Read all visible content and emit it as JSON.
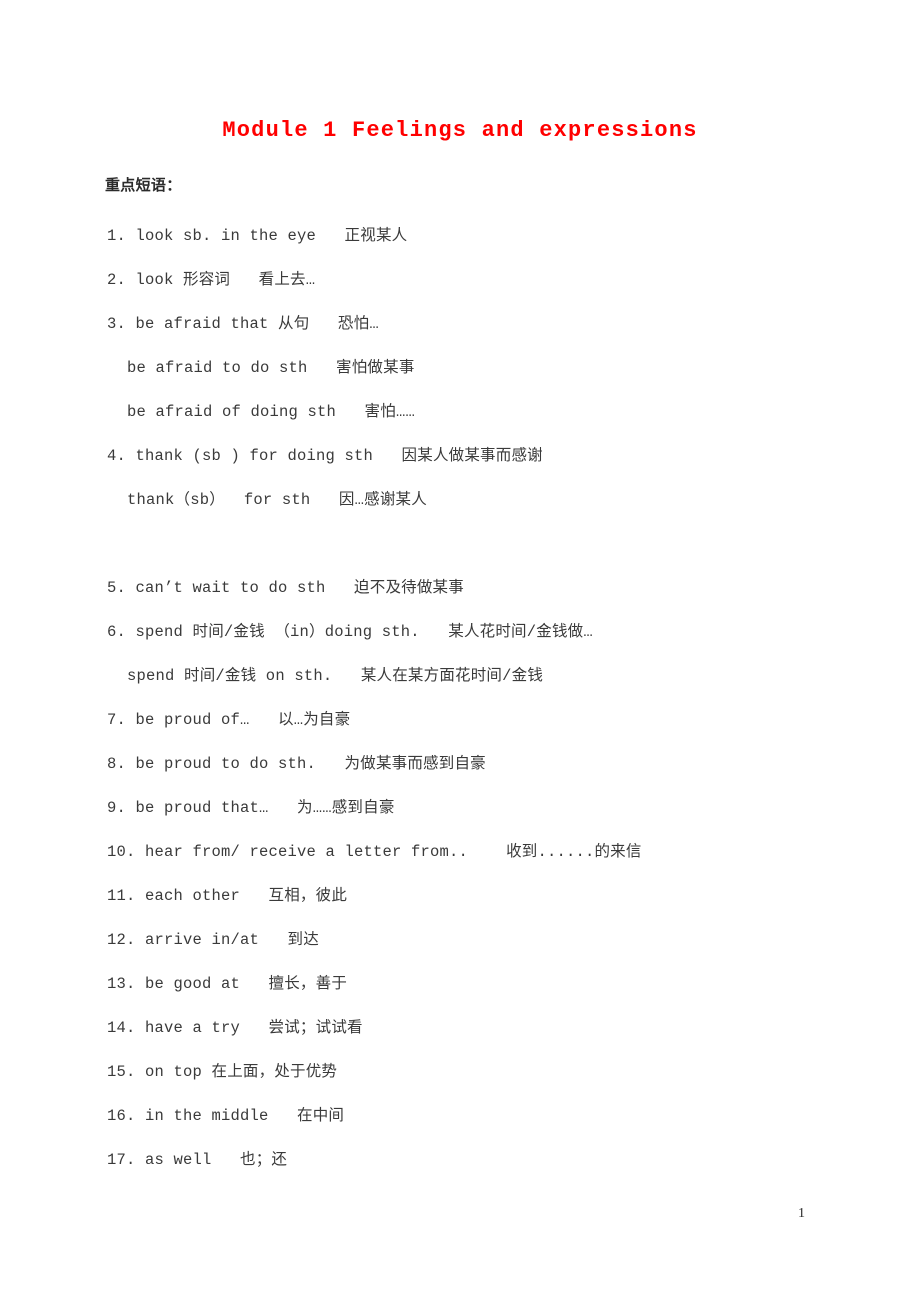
{
  "document": {
    "title": "Module 1 Feelings and expressions",
    "title_color": "#ff0000",
    "section_heading": "重点短语：",
    "page_number": "1",
    "body_text_color": "#3a3a3a",
    "background_color": "#ffffff"
  },
  "phrases": [
    {
      "level": 0,
      "text": "1. look sb. in the eye   正视某人"
    },
    {
      "level": 0,
      "text": "2. look 形容词   看上去…"
    },
    {
      "level": 0,
      "text": "3. be afraid that 从句   恐怕…"
    },
    {
      "level": 1,
      "text": "be afraid to do sth   害怕做某事"
    },
    {
      "level": 1,
      "text": "be afraid of doing sth   害怕……"
    },
    {
      "level": 0,
      "text": "4. thank (sb ) for doing sth   因某人做某事而感谢"
    },
    {
      "level": 1,
      "text": "thank（sb）  for sth   因…感谢某人"
    },
    {
      "level": 0,
      "text": ""
    },
    {
      "level": 0,
      "text": "5. can’t wait to do sth   迫不及待做某事"
    },
    {
      "level": 0,
      "text": "6. spend 时间/金钱 （in）doing sth.   某人花时间/金钱做…"
    },
    {
      "level": 1,
      "text": "spend 时间/金钱 on sth.   某人在某方面花时间/金钱"
    },
    {
      "level": 0,
      "text": "7. be proud of…   以…为自豪"
    },
    {
      "level": 0,
      "text": "8. be proud to do sth.   为做某事而感到自豪"
    },
    {
      "level": 0,
      "text": "9. be proud that…   为……感到自豪"
    },
    {
      "level": 0,
      "text": "10. hear from/ receive a letter from..    收到......的来信"
    },
    {
      "level": 0,
      "text": "11. each other   互相，彼此"
    },
    {
      "level": 0,
      "text": "12. arrive in/at   到达"
    },
    {
      "level": 0,
      "text": "13. be good at   擅长，善于"
    },
    {
      "level": 0,
      "text": "14. have a try   尝试；试试看"
    },
    {
      "level": 0,
      "text": "15. on top 在上面，处于优势"
    },
    {
      "level": 0,
      "text": "16. in the middle   在中间"
    },
    {
      "level": 0,
      "text": "17. as well   也；还"
    }
  ]
}
